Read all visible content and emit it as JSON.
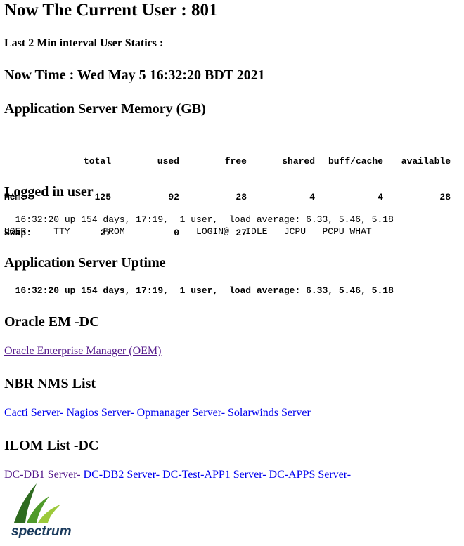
{
  "header": {
    "current_user": "Now The Current User : 801",
    "interval_stats": "Last 2 Min interval User Statics :",
    "now_time": "Now Time : Wed May 5 16:32:20 BDT 2021"
  },
  "memory": {
    "title": "Application Server Memory (GB)",
    "columns": [
      "total",
      "used",
      "free",
      "shared",
      "buff/cache",
      "available"
    ],
    "rows": [
      {
        "label": "Mem:",
        "values": [
          "125",
          "92",
          "28",
          "4",
          "4",
          "28"
        ]
      },
      {
        "label": "Swap:",
        "values": [
          "27",
          "0",
          "27",
          "",
          "",
          ""
        ]
      }
    ]
  },
  "logged_in": {
    "title": "Logged in user",
    "uptime_line": "  16:32:20 up 154 days, 17:19,  1 user,  load average: 6.33, 5.46, 5.18",
    "header_line": "USER     TTY      FROM             LOGIN@   IDLE   JCPU   PCPU WHAT"
  },
  "uptime": {
    "title": "Application Server Uptime",
    "line": "  16:32:20 up 154 days, 17:19,  1 user,  load average: 6.33, 5.46, 5.18"
  },
  "oracle": {
    "title": "Oracle EM -DC",
    "link": "Oracle Enterprise Manager (OEM)"
  },
  "nms": {
    "title": "NBR NMS List",
    "links": [
      "Cacti Server-",
      "Nagios Server-",
      "Opmanager Server-",
      "Solarwinds Server"
    ]
  },
  "ilom": {
    "title": "ILOM List -DC",
    "links": [
      "DC-DB1 Server-",
      "DC-DB2 Server-",
      "DC-Test-APP1 Server-",
      "DC-APPS Server-"
    ]
  },
  "logo": {
    "text": "spectrum",
    "colors": {
      "dark_green": "#2e6b1f",
      "mid_green": "#4f9a2a",
      "light_green": "#9cc93a",
      "text": "#1a3a5c"
    }
  },
  "colors": {
    "link": "#0000ee",
    "visited_link": "#551a8b"
  }
}
